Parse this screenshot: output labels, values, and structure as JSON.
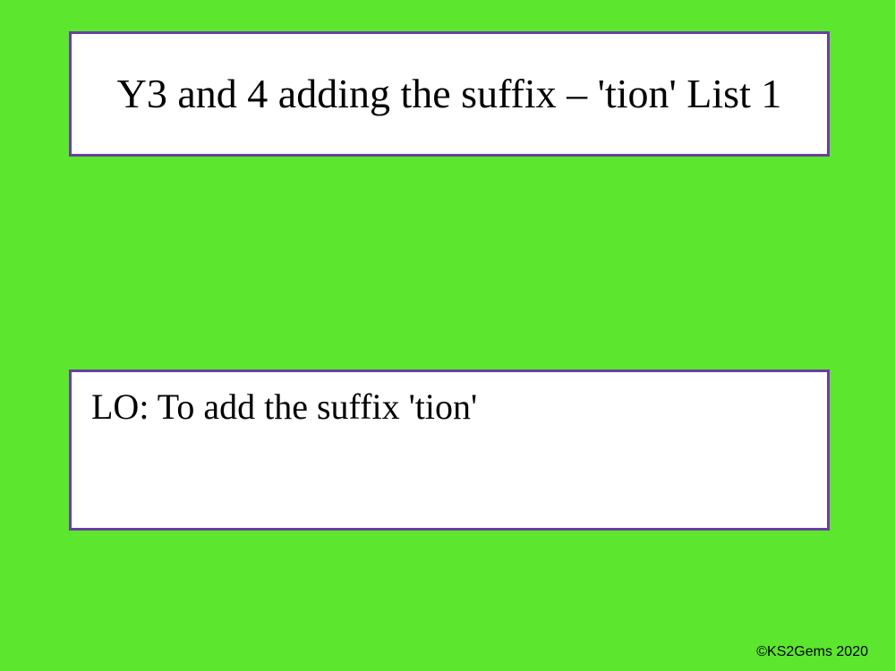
{
  "title": "Y3 and 4 adding the suffix – 'tion' List 1",
  "learning_objective": "LO: To add the suffix 'tion'",
  "copyright": "©KS2Gems 2020"
}
